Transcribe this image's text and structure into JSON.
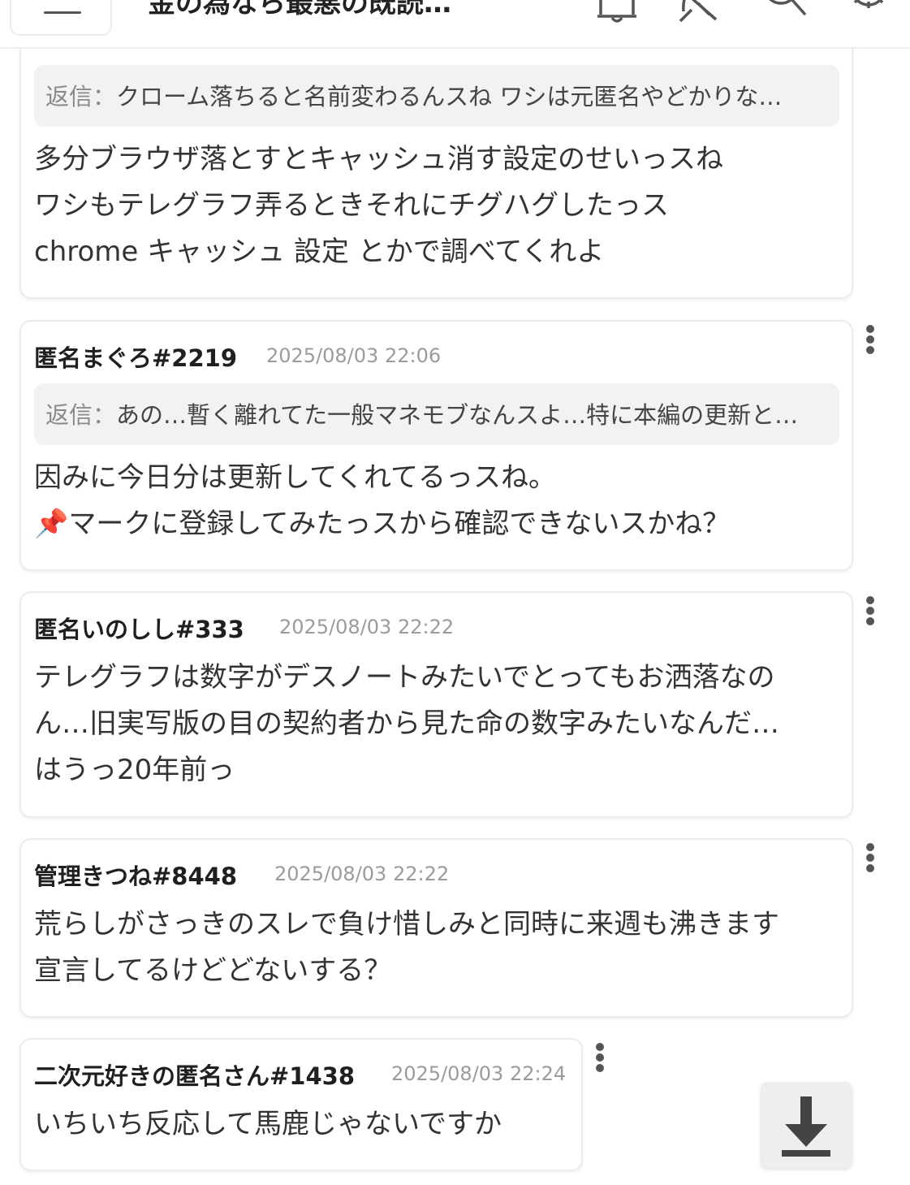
{
  "header": {
    "title": "金の為なら最悪の既読…",
    "icons": [
      "menu-icon",
      "bell-icon",
      "pin-off-icon",
      "search-icon",
      "gear-icon"
    ]
  },
  "posts": [
    {
      "reply_label": "返信：",
      "reply_text": "クローム落ちると名前変わるんスね ワシは元匿名やどかりな…",
      "body": [
        "多分ブラウザ落とすとキャッシュ消す設定のせいっスね",
        "ワシもテレグラフ弄るときそれにチグハグしたっス",
        "chrome キャッシュ 設定 とかで調べてくれよ"
      ]
    },
    {
      "name": "匿名まぐろ#2219",
      "time": "2025/08/03 22:06",
      "reply_label": "返信：",
      "reply_text": "あの…暫く離れてた一般マネモブなんスよ…特に本編の更新と…",
      "body": [
        "因みに今日分は更新してくれてるっスね。",
        "📌マークに登録してみたっスから確認できないスかね？"
      ]
    },
    {
      "name": "匿名いのしし#333",
      "time": "2025/08/03 22:22",
      "body": [
        "テレグラフは数字がデスノートみたいでとってもお洒落なの",
        "ん…旧実写版の目の契約者から見た命の数字みたいなんだ…",
        "はうっ20年前っ"
      ]
    },
    {
      "name": "管理きつね#8448",
      "time": "2025/08/03 22:22",
      "body": [
        "荒らしがさっきのスレで負け惜しみと同時に来週も沸きます",
        "宣言してるけどどないする？"
      ]
    },
    {
      "name": "二次元好きの匿名さん#1438",
      "time": "2025/08/03 22:24",
      "body": [
        "いちいち反応して馬鹿じゃないですか"
      ]
    }
  ],
  "colors": {
    "timestamp": "#9b9b9b",
    "reply_bg": "#f2f2f2",
    "card_border": "#ececec"
  }
}
